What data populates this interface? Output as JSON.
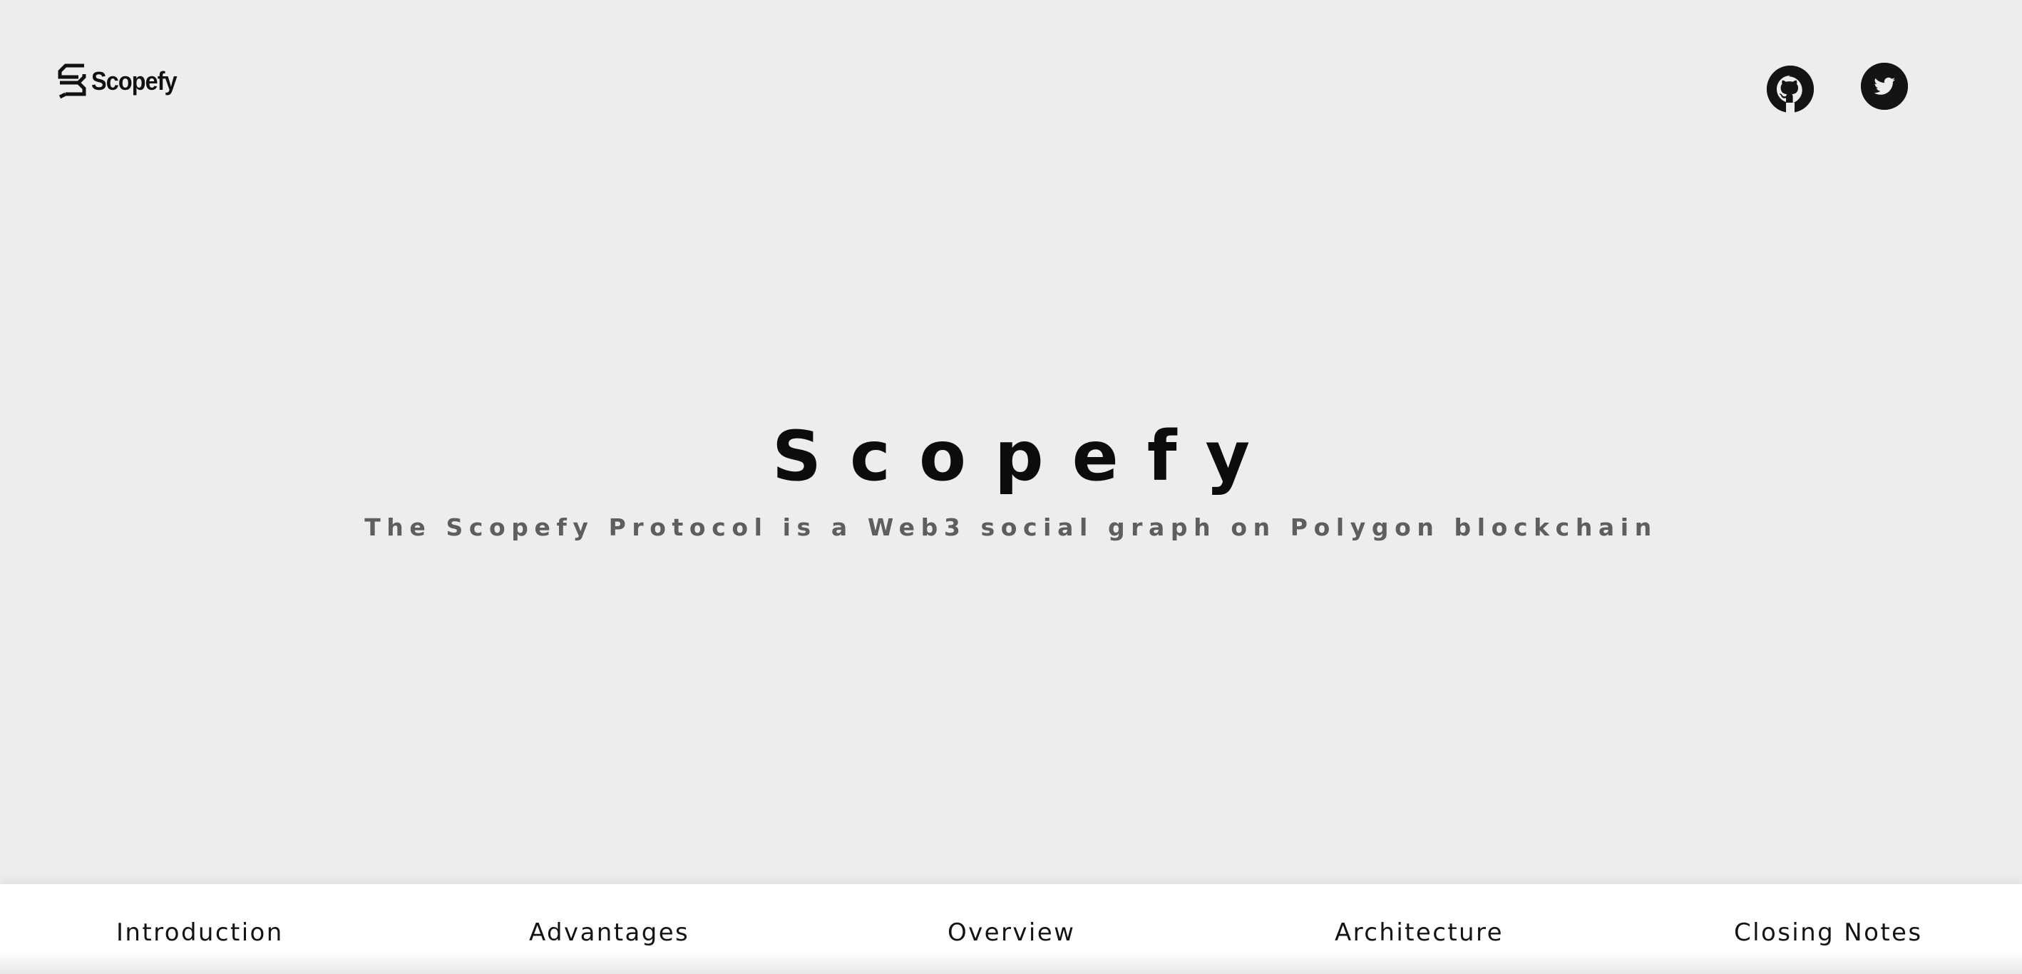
{
  "header": {
    "logo_text": "Scopefy",
    "logo_icon": "scopefy-logo-icon",
    "social_links": [
      {
        "name": "GitHub",
        "icon": "github-icon"
      },
      {
        "name": "Twitter",
        "icon": "twitter-icon"
      }
    ]
  },
  "hero": {
    "title": "Scopefy",
    "subtitle": "The Scopefy Protocol is a Web3 social graph on Polygon blockchain"
  },
  "nav": {
    "items": [
      {
        "label": "Introduction"
      },
      {
        "label": "Advantages"
      },
      {
        "label": "Overview"
      },
      {
        "label": "Architecture"
      },
      {
        "label": "Closing Notes"
      }
    ]
  },
  "colors": {
    "background": "#ededed",
    "nav_background": "#ffffff",
    "title": "#0c0c0c",
    "subtitle": "#5e5e5e",
    "icon_circle": "#141414"
  }
}
